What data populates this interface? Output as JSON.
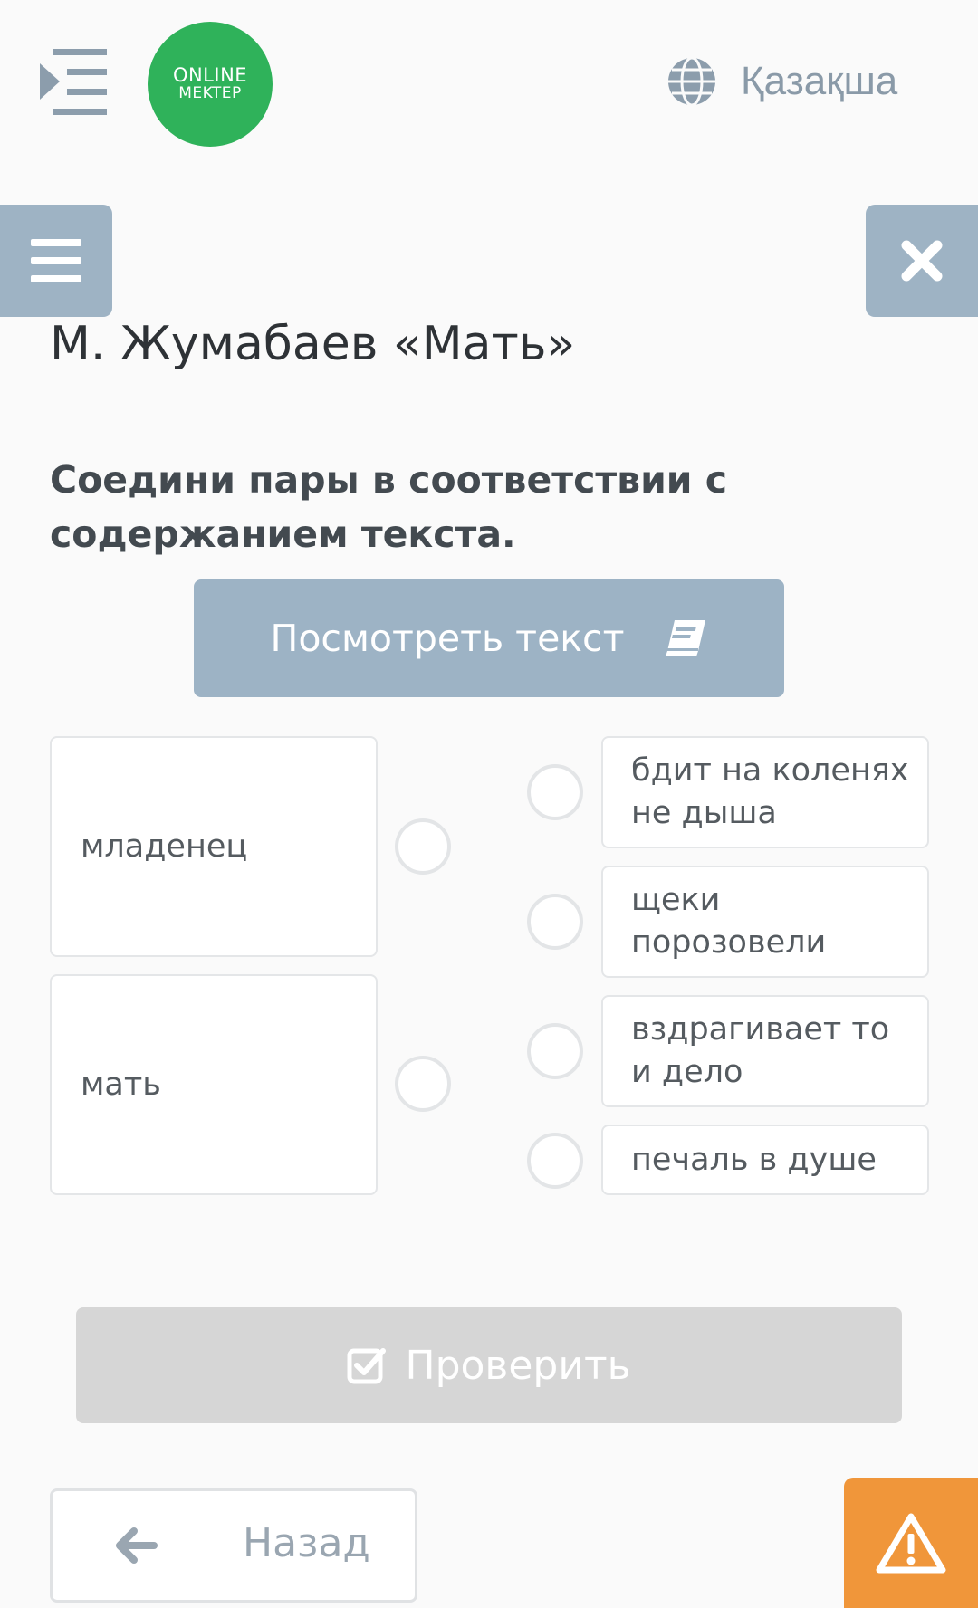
{
  "header": {
    "menu_icon": "indent-menu-icon",
    "logo_line1": "ONLINE",
    "logo_line2": "MEKTEP",
    "language_icon": "globe-icon",
    "language": "Қазақша"
  },
  "sidebar_toggle_icon": "hamburger-icon",
  "close_icon": "close-icon",
  "lesson_title": "М. Жумабаев «Мать»",
  "instruction": "Соедини пары в соответствии с содержанием текста.",
  "view_text": {
    "label": "Посмотреть текст",
    "icon": "book-icon"
  },
  "left_items": [
    "младенец",
    "мать"
  ],
  "right_items": [
    "бдит на коленях не дыша",
    "щеки порозовели",
    "вздрагивает то и дело",
    "печаль в душе"
  ],
  "check": {
    "label": "Проверить",
    "icon": "check-square-icon"
  },
  "back": {
    "label": "Назад",
    "icon": "arrow-left-icon"
  },
  "report_icon": "warning-icon",
  "colors": {
    "accent": "#9db3c5",
    "logo": "#2fb25a",
    "warning": "#f0963a",
    "disabled": "#d6d6d6"
  }
}
